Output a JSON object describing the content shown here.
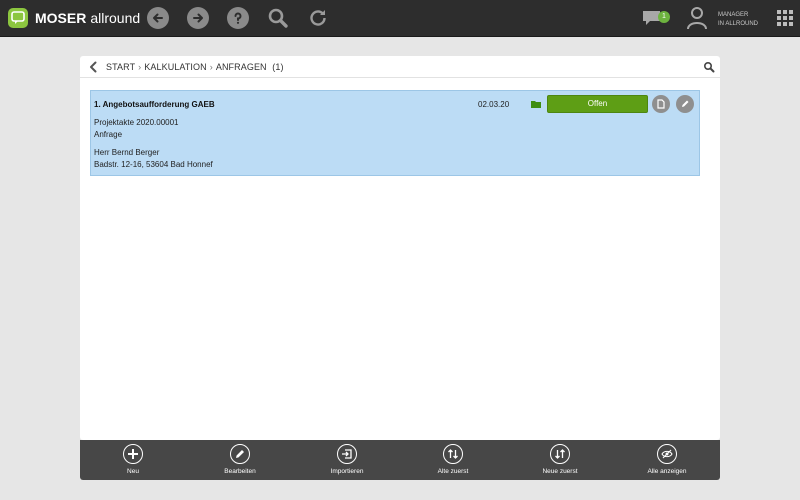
{
  "app": {
    "brand_bold": "MOSER",
    "brand_light": "allround",
    "colors": {
      "brand_green": "#8cc63f",
      "topbar": "#2d2d2d",
      "row_selected": "#bcdcf5",
      "status_green": "#5e9e15",
      "toolbar": "#474747"
    }
  },
  "topbar": {
    "icons": [
      "back-arrow-icon",
      "forward-arrow-icon",
      "help-icon",
      "search-icon",
      "refresh-icon"
    ],
    "chat_badge": "1",
    "user_line1": "MANAGER",
    "user_line2": "IN ALLROUND"
  },
  "breadcrumb": {
    "items": [
      "START",
      "KALKULATION",
      "ANFRAGEN"
    ],
    "separator": "›",
    "count": "(1)"
  },
  "list": {
    "items": [
      {
        "title": "1. Angebotsaufforderung GAEB",
        "date": "02.03.20",
        "status": "Offen",
        "project": "Projektakte 2020.00001",
        "type": "Anfrage",
        "contact_name": "Herr Bernd Berger",
        "contact_address": "Badstr. 12-16, 53604 Bad Honnef"
      }
    ]
  },
  "toolbar": {
    "items": [
      {
        "label": "Neu",
        "icon": "plus-icon"
      },
      {
        "label": "Bearbeiten",
        "icon": "pencil-icon"
      },
      {
        "label": "Importieren",
        "icon": "import-icon"
      },
      {
        "label": "Alte zuerst",
        "icon": "sort-ascending-icon"
      },
      {
        "label": "Neue zuerst",
        "icon": "sort-descending-icon"
      },
      {
        "label": "Alle anzeigen",
        "icon": "eye-off-icon"
      }
    ]
  }
}
